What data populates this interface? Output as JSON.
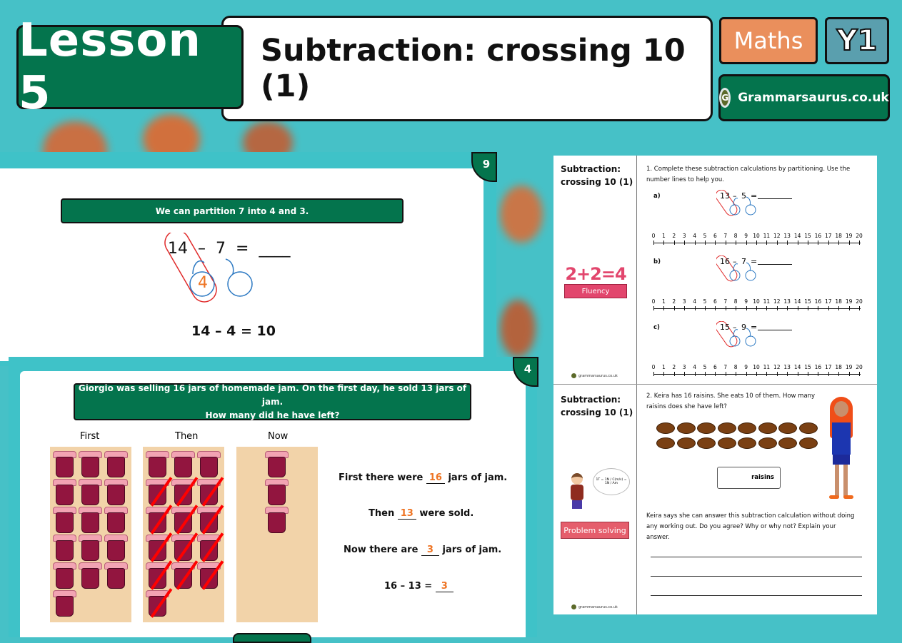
{
  "header": {
    "lesson_label": "Lesson 5",
    "title": "Subtraction: crossing 10 (1)",
    "subject": "Maths",
    "year": "Y1",
    "brand": "Grammarsaurus.co.uk",
    "brand_logo_letter": "G"
  },
  "slide_back": {
    "number": "9",
    "banner": "We can partition 7 into 4 and 3.",
    "equation": {
      "a": "14",
      "op": "–",
      "b": "7",
      "eq": "=",
      "blank": "____"
    },
    "partition_left": "4",
    "result": "14 – 4 = 10"
  },
  "slide_front": {
    "number": "4",
    "banner_line1": "Giorgio was selling 16 jars of  homemade jam. On the first day, he sold 13 jars of jam.",
    "banner_line2": "How many did he have left?",
    "columns": [
      {
        "label": "First",
        "jars": 16,
        "crossed": 0
      },
      {
        "label": "Then",
        "jars": 16,
        "crossed": 13
      },
      {
        "label": "Now",
        "jars": 3,
        "crossed": 0
      }
    ],
    "sentences": [
      {
        "before": "First there were ",
        "answer": "16",
        "after": " jars of jam."
      },
      {
        "before": "Then ",
        "answer": "13",
        "after": " were sold."
      },
      {
        "before": "Now there are ",
        "answer": "3",
        "after": " jars of jam."
      },
      {
        "before": "16 – 13 = ",
        "answer": "3",
        "after": ""
      }
    ]
  },
  "worksheet": {
    "section1": {
      "title_line1": "Subtraction:",
      "title_line2": "crossing 10 (1)",
      "badge_equation": "2+2=4",
      "badge_label": "Fluency",
      "instruction": "1. Complete these subtraction calculations by partitioning. Use the number lines to help you.",
      "questions": [
        {
          "label": "a)",
          "a": "13",
          "b": "5"
        },
        {
          "label": "b)",
          "a": "16",
          "b": "7"
        },
        {
          "label": "c)",
          "a": "15",
          "b": "9"
        }
      ],
      "numberline": [
        "0",
        "1",
        "2",
        "3",
        "4",
        "5",
        "6",
        "7",
        "8",
        "9",
        "10",
        "11",
        "12",
        "13",
        "14",
        "15",
        "16",
        "17",
        "18",
        "19",
        "20"
      ],
      "footer": "grammarsaurus.co.uk"
    },
    "section2": {
      "title_line1": "Subtraction:",
      "title_line2": "crossing 10 (1)",
      "badge_label": "Problem solving",
      "thought_formula": "1T = 1N / C(m/s) = 1N / Am",
      "question": "2. Keira has 16 raisins. She eats 10 of them. How many raisins does she have left?",
      "raisin_count": 16,
      "answer_unit": "raisins",
      "prompt": "Keira says she can answer this subtraction calculation without doing any working out. Do you agree? Why or why not? Explain your answer.",
      "footer": "grammarsaurus.co.uk"
    }
  }
}
